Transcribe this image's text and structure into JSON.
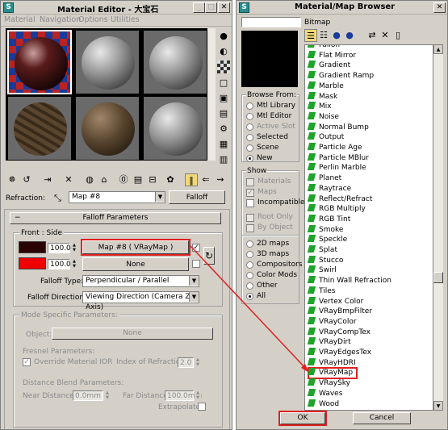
{
  "material_editor": {
    "title": "Material Editor - 大宝石",
    "menu": [
      "Material",
      "Navigation",
      "Options",
      "Utilities"
    ],
    "refraction_label": "Refraction:",
    "map_name": "Map #8",
    "map_type": "Falloff",
    "rollout_title": "Falloff Parameters",
    "front_side_label": "Front : Side",
    "front_amount": "100.0",
    "front_map": "Map #8  ( VRayMap )",
    "side_amount": "100.0",
    "side_map": "None",
    "falloff_type_label": "Falloff Type:",
    "falloff_type_value": "Perpendicular / Parallel",
    "falloff_dir_label": "Falloff Direction:",
    "falloff_dir_value": "Viewing Direction (Camera Z-Axis)",
    "mode_label": "Mode Specific Parameters:",
    "object_label": "Object:",
    "object_value": "None",
    "fresnel_label": "Fresnel Parameters:",
    "override_ior_label": "Override Material IOR",
    "ior_label": "Index of Refraction",
    "ior_value": "2.0",
    "distance_label": "Distance Blend Parameters:",
    "near_label": "Near Distance:",
    "near_value": "0.0mm",
    "far_label": "Far Distance:",
    "far_value": "100.0mm",
    "extrapolate_label": "Extrapolate",
    "colors": {
      "front": "#2a0404",
      "side": "#ee0000"
    }
  },
  "map_browser": {
    "title": "Material/Map Browser",
    "search_value": "",
    "current": "Bitmap",
    "browse_from_label": "Browse From:",
    "browse_from": [
      {
        "label": "Mtl Library",
        "on": false,
        "enabled": true
      },
      {
        "label": "Mtl Editor",
        "on": false,
        "enabled": true
      },
      {
        "label": "Active Slot",
        "on": false,
        "enabled": false
      },
      {
        "label": "Selected",
        "on": false,
        "enabled": true
      },
      {
        "label": "Scene",
        "on": false,
        "enabled": true
      },
      {
        "label": "New",
        "on": true,
        "enabled": true
      }
    ],
    "show_label": "Show",
    "show": [
      {
        "label": "Materials",
        "checked": false,
        "enabled": false
      },
      {
        "label": "Maps",
        "checked": true,
        "enabled": false
      },
      {
        "label": "Incompatible",
        "checked": false,
        "enabled": true
      }
    ],
    "root_only": "Root Only",
    "by_object": "By Object",
    "map_filter": [
      {
        "label": "2D maps",
        "on": false
      },
      {
        "label": "3D maps",
        "on": false
      },
      {
        "label": "Compositors",
        "on": false
      },
      {
        "label": "Color Mods",
        "on": false
      },
      {
        "label": "Other",
        "on": false
      },
      {
        "label": "All",
        "on": true
      }
    ],
    "items": [
      "Fallon",
      "Flat Mirror",
      "Gradient",
      "Gradient Ramp",
      "Marble",
      "Mask",
      "Mix",
      "Noise",
      "Normal Bump",
      "Output",
      "Particle Age",
      "Particle MBlur",
      "Perlin Marble",
      "Planet",
      "Raytrace",
      "Reflect/Refract",
      "RGB Multiply",
      "RGB Tint",
      "Smoke",
      "Speckle",
      "Splat",
      "Stucco",
      "Swirl",
      "Thin Wall Refraction",
      "Tiles",
      "Vertex Color",
      "VRayBmpFilter",
      "VRayColor",
      "VRayCompTex",
      "VRayDirt",
      "VRayEdgesTex",
      "VRayHDRI",
      "VRayMap",
      "VRaySky",
      "Waves",
      "Wood"
    ],
    "ok_label": "OK",
    "cancel_label": "Cancel",
    "highlight_color": "#e02020"
  }
}
